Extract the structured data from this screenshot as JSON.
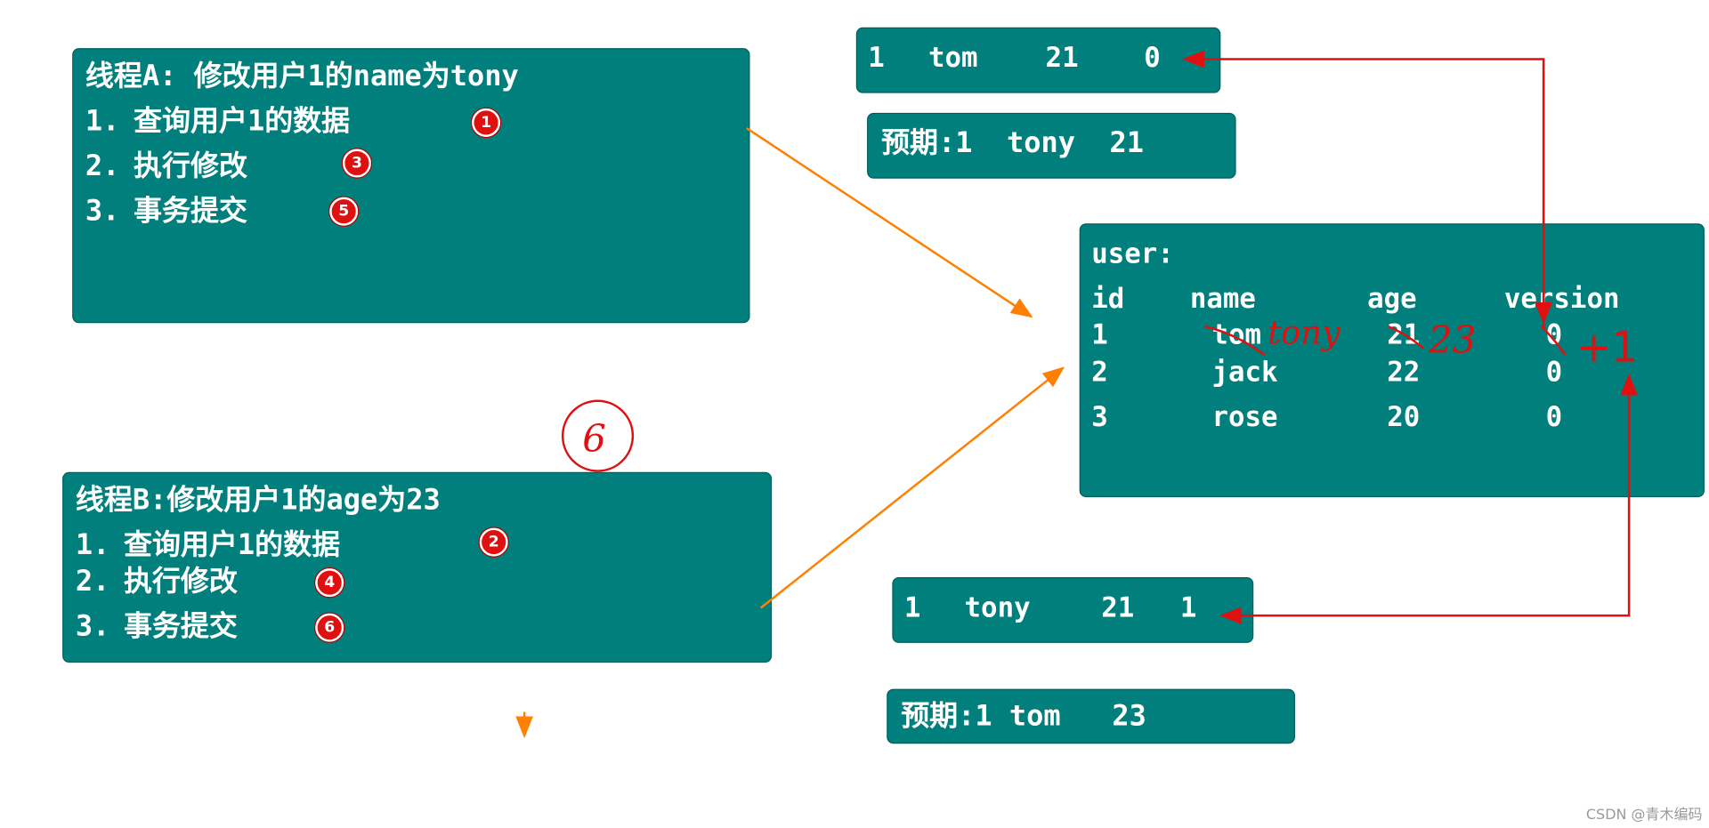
{
  "thread_a": {
    "title": "线程A: 修改用户1的name为tony",
    "steps": [
      {
        "index": "1.",
        "text": "查询用户1的数据",
        "badge": "1"
      },
      {
        "index": "2.",
        "text": "执行修改",
        "badge": "3"
      },
      {
        "index": "3.",
        "text": "事务提交",
        "badge": "5"
      }
    ]
  },
  "thread_b": {
    "title": "线程B:修改用户1的age为23",
    "steps": [
      {
        "index": "1.",
        "text": "查询用户1的数据",
        "badge": "2"
      },
      {
        "index": "2.",
        "text": "执行修改",
        "badge": "4"
      },
      {
        "index": "3.",
        "text": "事务提交",
        "badge": "6"
      }
    ]
  },
  "read_a": {
    "id": "1",
    "name": "tom",
    "age": "21",
    "version": "0"
  },
  "expect_a": {
    "text": "预期:1  tony  21"
  },
  "read_b": {
    "id": "1",
    "name": "tony",
    "age": "21",
    "version": "1"
  },
  "expect_b": {
    "text": "预期:1 tom   23"
  },
  "table": {
    "title": "user:",
    "headers": [
      "id",
      "name",
      "age",
      "version"
    ],
    "rows": [
      [
        "1",
        "tom",
        "21",
        "0"
      ],
      [
        "2",
        "jack",
        "22",
        "0"
      ],
      [
        "3",
        "rose",
        "20",
        "0"
      ]
    ]
  },
  "handwritten": {
    "name_new": "tony",
    "age_new": "23",
    "version_inc": "+1",
    "step_mark": "6"
  },
  "watermark": "CSDN @青木编码",
  "colors": {
    "box": "#007f7c",
    "orange_arrow": "#ff8000",
    "red_arrow": "#e01010"
  }
}
